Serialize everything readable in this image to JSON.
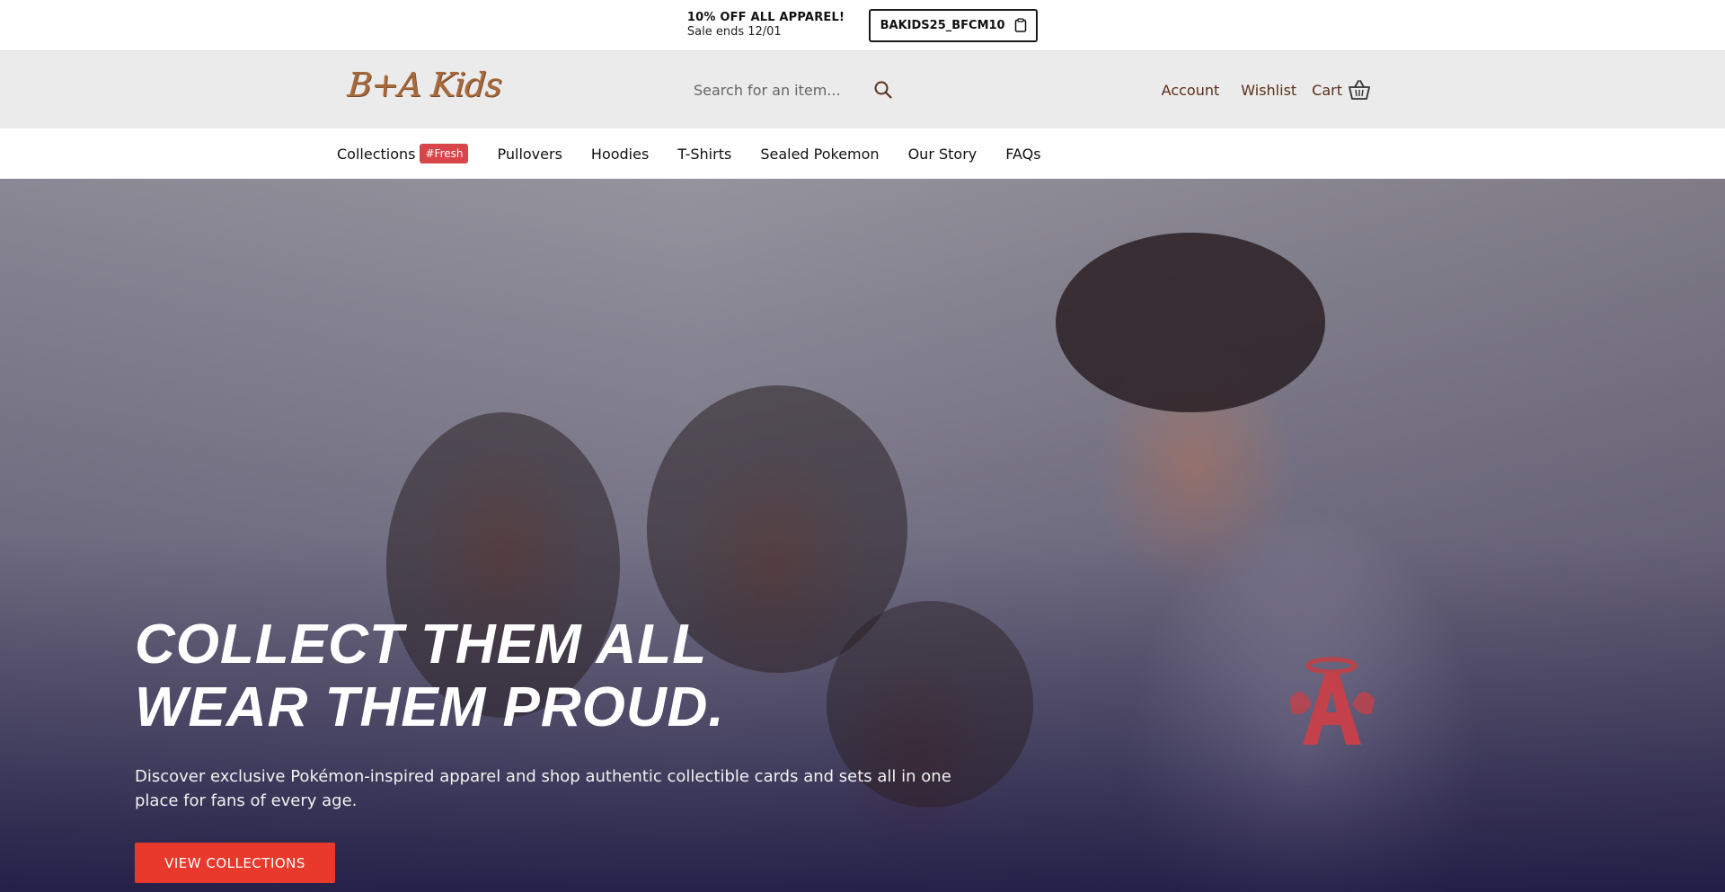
{
  "announcement": {
    "title": "10% OFF ALL APPAREL!",
    "subtitle": "Sale ends 12/01",
    "promo_code": "BAKIDS25_BFCM10"
  },
  "header": {
    "logo_text": "B+A Kids",
    "search_placeholder": "Search for an item...",
    "links": {
      "account": "Account",
      "wishlist": "Wishlist",
      "cart": "Cart"
    }
  },
  "nav": {
    "items": [
      {
        "label": "Collections",
        "badge": "#Fresh"
      },
      {
        "label": "Pullovers"
      },
      {
        "label": "Hoodies"
      },
      {
        "label": "T-Shirts"
      },
      {
        "label": "Sealed Pokemon"
      },
      {
        "label": "Our Story"
      },
      {
        "label": "FAQs"
      }
    ]
  },
  "hero": {
    "title_line1": "COLLECT THEM ALL",
    "title_line2": "WEAR THEM PROUD.",
    "description": "Discover exclusive Pokémon-inspired apparel and shop authentic collectible cards and sets all in one place for fans of every age.",
    "button_label": "VIEW COLLECTIONS"
  },
  "colors": {
    "brand": "#a86a3c",
    "header_link": "#5a2f1a",
    "cta": "#e8392c",
    "badge": "#d8454a"
  }
}
